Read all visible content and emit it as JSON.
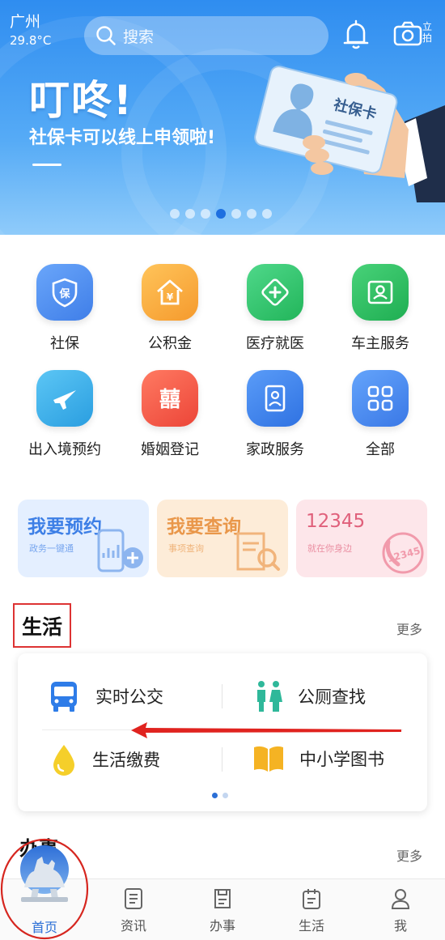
{
  "status": {
    "city": "广州",
    "temperature": "29.8°C"
  },
  "search": {
    "placeholder": "搜索"
  },
  "camera": {
    "label": "立拍"
  },
  "banner": {
    "title": "叮咚!",
    "subtitle": "社保卡可以线上申领啦!",
    "card_text": "社保卡",
    "page_count": 7,
    "active_page": 4
  },
  "services": [
    {
      "label": "社保",
      "icon": "social-security-icon",
      "color": "#4f8df0"
    },
    {
      "label": "公积金",
      "icon": "housing-fund-icon",
      "color": "#f7a93a"
    },
    {
      "label": "医疗就医",
      "icon": "medical-icon",
      "color": "#2fc26a"
    },
    {
      "label": "车主服务",
      "icon": "car-owner-icon",
      "color": "#26b85e"
    },
    {
      "label": "出入境预约",
      "icon": "airplane-icon",
      "color": "#2fa8e6"
    },
    {
      "label": "婚姻登记",
      "icon": "marriage-icon",
      "color": "#f2574b"
    },
    {
      "label": "家政服务",
      "icon": "housekeeping-icon",
      "color": "#3f86ee"
    },
    {
      "label": "全部",
      "icon": "grid-icon",
      "color": "#4a8df0"
    }
  ],
  "quick_links": [
    {
      "title": "我要预约",
      "subtitle": "政务一键通",
      "bg": "#e4efff",
      "fg": "#3d7fe6"
    },
    {
      "title": "我要查询",
      "subtitle": "事项查询",
      "bg": "#fdecd8",
      "fg": "#e9974a"
    },
    {
      "title": "12345",
      "subtitle": "就在你身边",
      "bg": "#fde6ea",
      "fg": "#e0607b"
    }
  ],
  "life_section": {
    "title": "生活",
    "more": "更多",
    "items": [
      {
        "label": "实时公交",
        "icon": "bus-icon"
      },
      {
        "label": "公厕查找",
        "icon": "restroom-icon"
      },
      {
        "label": "生活缴费",
        "icon": "water-drop-icon"
      },
      {
        "label": "中小学图书",
        "icon": "book-icon"
      }
    ],
    "page_count": 2,
    "active_page": 1
  },
  "work_section": {
    "title": "办事",
    "more": "更多"
  },
  "tabbar": [
    {
      "label": "首页",
      "icon": "home-icon",
      "active": true
    },
    {
      "label": "资讯",
      "icon": "news-icon",
      "active": false
    },
    {
      "label": "办事",
      "icon": "services-icon",
      "active": false
    },
    {
      "label": "生活",
      "icon": "life-icon",
      "active": false
    },
    {
      "label": "我",
      "icon": "profile-icon",
      "active": false
    }
  ]
}
